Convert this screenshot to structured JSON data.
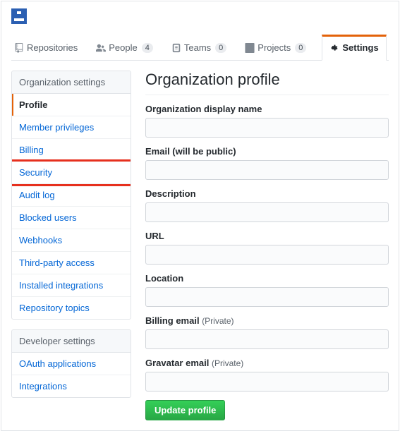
{
  "tabs": {
    "repositories": {
      "label": "Repositories"
    },
    "people": {
      "label": "People",
      "count": "4"
    },
    "teams": {
      "label": "Teams",
      "count": "0"
    },
    "projects": {
      "label": "Projects",
      "count": "0"
    },
    "settings": {
      "label": "Settings"
    }
  },
  "sidebar": {
    "org_header": "Organization settings",
    "org_items": [
      "Profile",
      "Member privileges",
      "Billing",
      "Security",
      "Audit log",
      "Blocked users",
      "Webhooks",
      "Third-party access",
      "Installed integrations",
      "Repository topics"
    ],
    "dev_header": "Developer settings",
    "dev_items": [
      "OAuth applications",
      "Integrations"
    ]
  },
  "page": {
    "title": "Organization profile",
    "fields": {
      "display_name": {
        "label": "Organization display name"
      },
      "email": {
        "label": "Email (will be public)"
      },
      "description": {
        "label": "Description"
      },
      "url": {
        "label": "URL"
      },
      "location": {
        "label": "Location"
      },
      "billing_email": {
        "label": "Billing email ",
        "note": "(Private)"
      },
      "gravatar_email": {
        "label": "Gravatar email ",
        "note": "(Private)"
      }
    },
    "submit_label": "Update profile"
  }
}
